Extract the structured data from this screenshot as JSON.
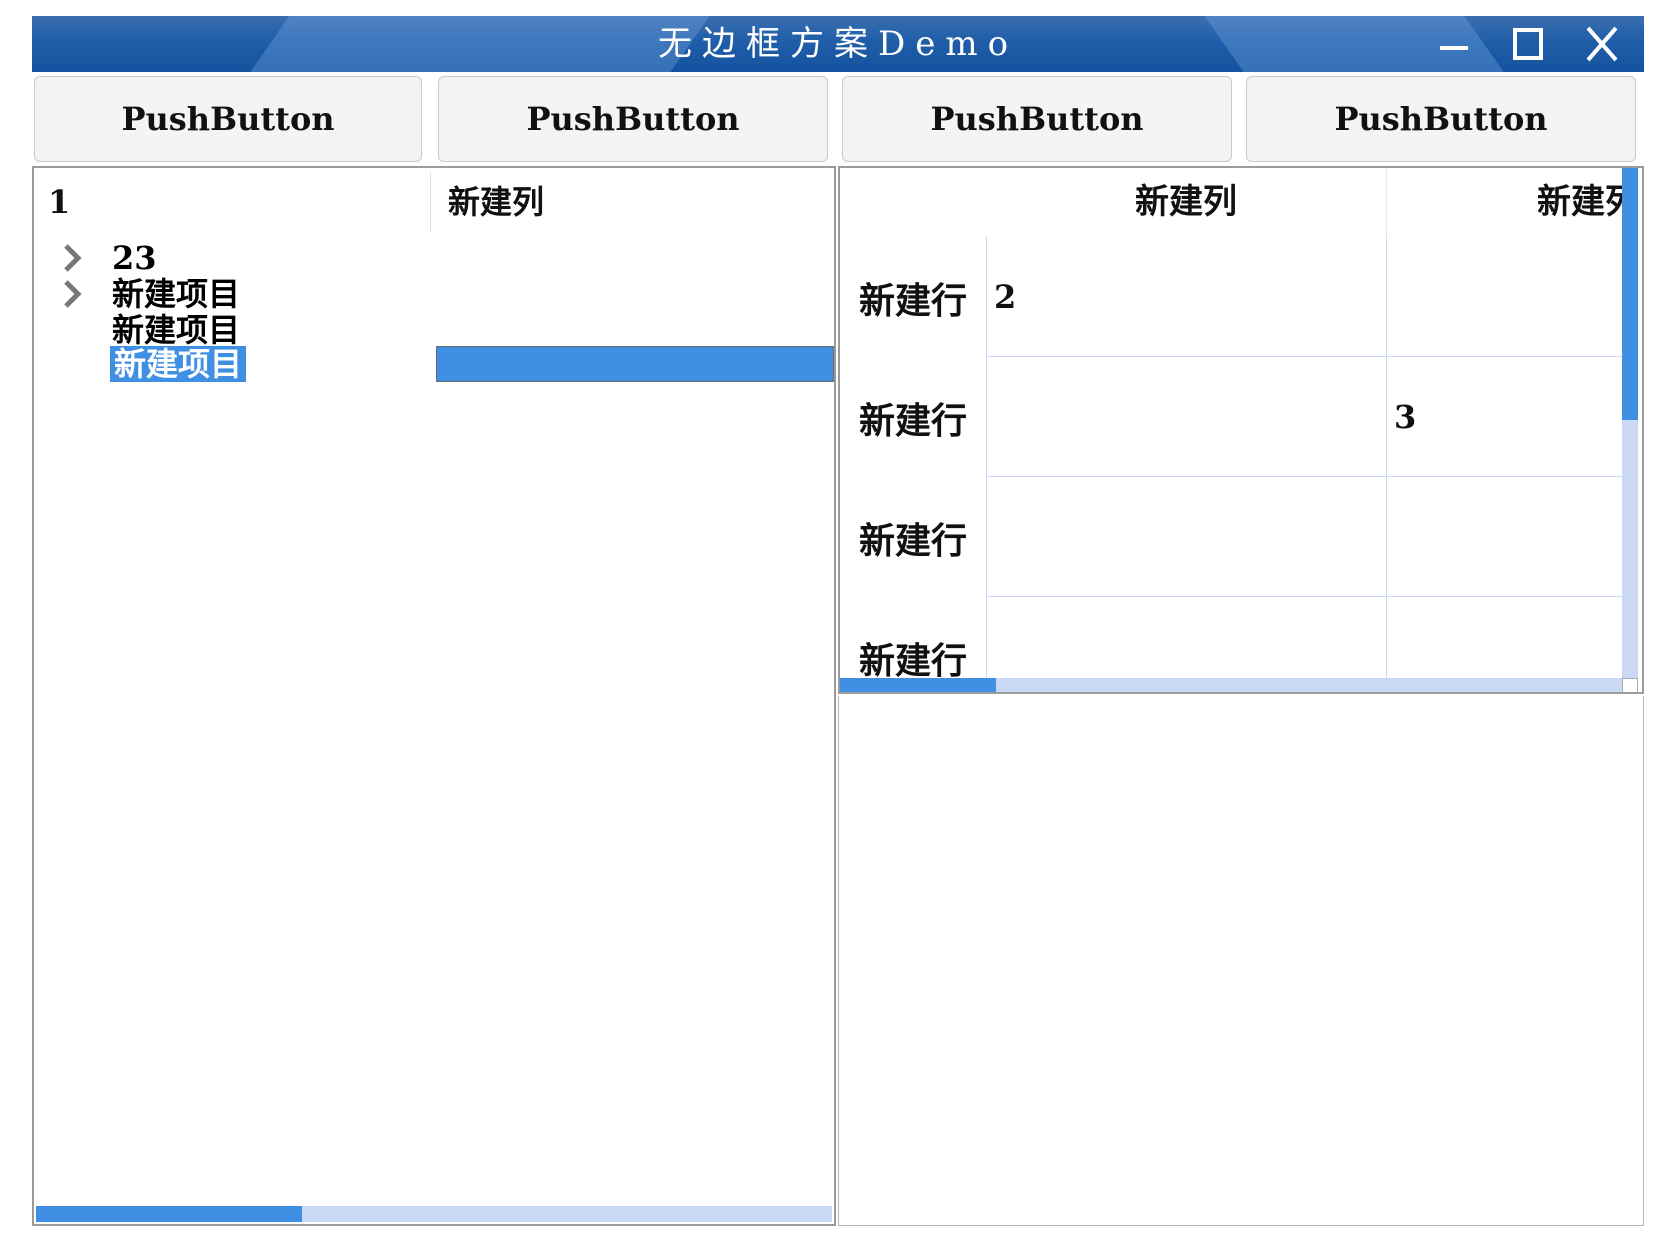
{
  "window": {
    "title": "无边框方案Demo",
    "accent": "#1f5ea8"
  },
  "toolbar": {
    "buttons": [
      "PushButton",
      "PushButton",
      "PushButton",
      "PushButton"
    ]
  },
  "tree": {
    "headers": [
      "1",
      "新建列"
    ],
    "items": [
      "23",
      "新建项目",
      "新建项目",
      "新建项目"
    ],
    "selected_index": 3,
    "selection_color": "#3f8fe5"
  },
  "table": {
    "column_headers": [
      "新建列",
      "新建列"
    ],
    "row_headers": [
      "新建行",
      "新建行",
      "新建行",
      "新建行"
    ],
    "cells": [
      [
        "2",
        ""
      ],
      [
        "",
        "3"
      ],
      [
        "",
        ""
      ],
      [
        "",
        ""
      ]
    ]
  }
}
